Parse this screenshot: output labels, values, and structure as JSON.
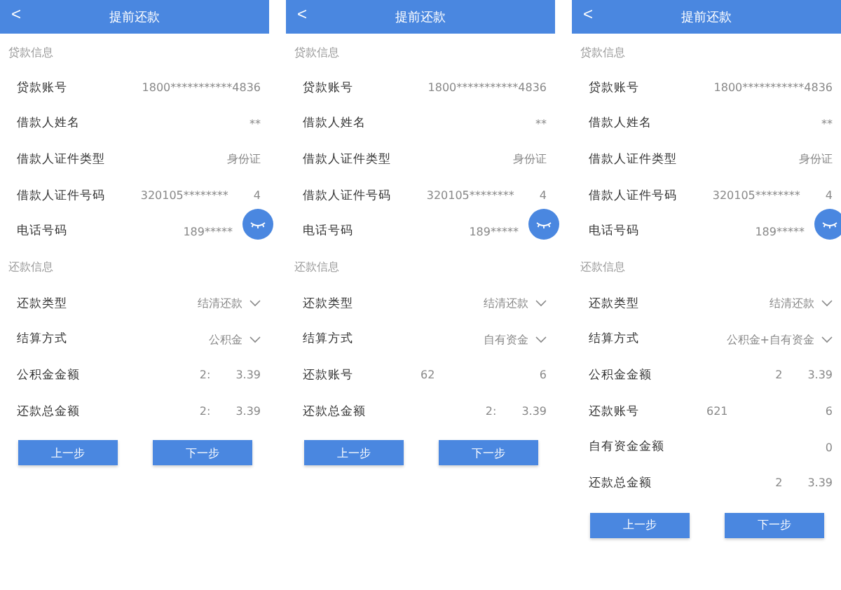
{
  "screens": [
    {
      "title": "提前还款",
      "back": "<",
      "sections": [
        {
          "heading": "贷款信息",
          "rows": [
            {
              "label": "贷款账号",
              "kind": "text",
              "parts": [
                "1800***********4836"
              ]
            },
            {
              "label": "借款人姓名",
              "kind": "text",
              "parts": [
                "**"
              ]
            },
            {
              "label": "借款人证件类型",
              "kind": "text",
              "parts": [
                "身份证"
              ]
            },
            {
              "label": "借款人证件号码",
              "kind": "masked",
              "parts": [
                "320105********",
                "4"
              ]
            },
            {
              "label": "电话号码",
              "kind": "partial",
              "parts": [
                "189*****"
              ]
            }
          ]
        },
        {
          "heading": "还款信息",
          "rows": [
            {
              "label": "还款类型",
              "kind": "select",
              "parts": [
                "结清还款"
              ]
            },
            {
              "label": "结算方式",
              "kind": "select",
              "parts": [
                "公积金"
              ]
            },
            {
              "label": "公积金金额",
              "kind": "masked",
              "parts": [
                "2:",
                "3.39"
              ]
            },
            {
              "label": "还款总金额",
              "kind": "masked",
              "parts": [
                "2:",
                "3.39"
              ]
            }
          ]
        }
      ],
      "buttons": [
        "上一步",
        "下一步"
      ]
    },
    {
      "title": "提前还款",
      "back": "<",
      "sections": [
        {
          "heading": "贷款信息",
          "rows": [
            {
              "label": "贷款账号",
              "kind": "text",
              "parts": [
                "1800***********4836"
              ]
            },
            {
              "label": "借款人姓名",
              "kind": "text",
              "parts": [
                "**"
              ]
            },
            {
              "label": "借款人证件类型",
              "kind": "text",
              "parts": [
                "身份证"
              ]
            },
            {
              "label": "借款人证件号码",
              "kind": "masked",
              "parts": [
                "320105********",
                "4"
              ]
            },
            {
              "label": "电话号码",
              "kind": "partial",
              "parts": [
                "189*****"
              ]
            }
          ]
        },
        {
          "heading": "还款信息",
          "rows": [
            {
              "label": "还款类型",
              "kind": "select",
              "parts": [
                "结清还款"
              ]
            },
            {
              "label": "结算方式",
              "kind": "select",
              "parts": [
                "自有资金"
              ]
            },
            {
              "label": "还款账号",
              "kind": "spread",
              "parts": [
                "62",
                "6"
              ]
            },
            {
              "label": "还款总金额",
              "kind": "masked",
              "parts": [
                "2:",
                "3.39"
              ]
            }
          ]
        }
      ],
      "buttons": [
        "上一步",
        "下一步"
      ]
    },
    {
      "title": "提前还款",
      "back": "<",
      "sections": [
        {
          "heading": "贷款信息",
          "rows": [
            {
              "label": "贷款账号",
              "kind": "text",
              "parts": [
                "1800***********4836"
              ]
            },
            {
              "label": "借款人姓名",
              "kind": "text",
              "parts": [
                "**"
              ]
            },
            {
              "label": "借款人证件类型",
              "kind": "text",
              "parts": [
                "身份证"
              ]
            },
            {
              "label": "借款人证件号码",
              "kind": "masked",
              "parts": [
                "320105********",
                "4"
              ]
            },
            {
              "label": "电话号码",
              "kind": "partial",
              "parts": [
                "189*****"
              ]
            }
          ]
        },
        {
          "heading": "还款信息",
          "rows": [
            {
              "label": "还款类型",
              "kind": "select",
              "parts": [
                "结清还款"
              ]
            },
            {
              "label": "结算方式",
              "kind": "select",
              "parts": [
                "公积金+自有资金"
              ]
            },
            {
              "label": "公积金金额",
              "kind": "masked",
              "parts": [
                "2",
                "3.39"
              ]
            },
            {
              "label": "还款账号",
              "kind": "spread",
              "parts": [
                "621",
                "6"
              ]
            },
            {
              "label": "自有资金金额",
              "kind": "text",
              "parts": [
                "0"
              ]
            },
            {
              "label": "还款总金额",
              "kind": "masked",
              "parts": [
                "2",
                "3.39"
              ]
            }
          ]
        }
      ],
      "buttons": [
        "上一步",
        "下一步"
      ]
    }
  ]
}
